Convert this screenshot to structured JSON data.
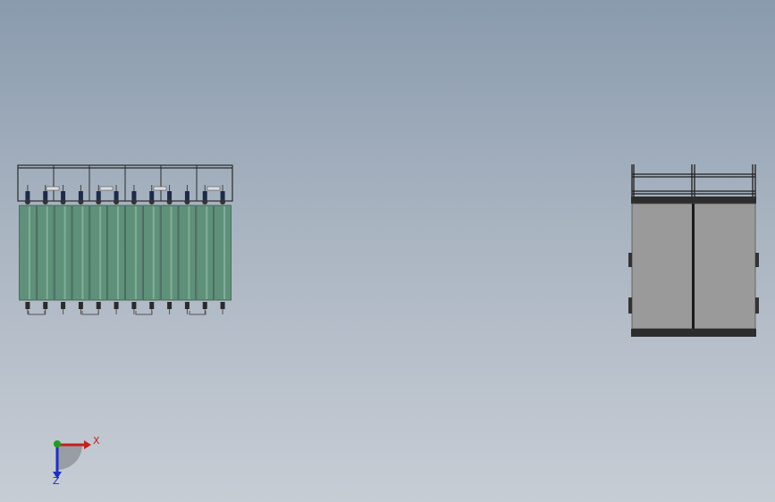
{
  "scene": {
    "background_top": "#8a9bae",
    "background_bottom": "#c7cdd5",
    "left_part": {
      "name": "cylinder-rack-front-view",
      "cylinder_count": 12,
      "cylinder_color": "#5f917a",
      "frame_color": "#2b2b2b"
    },
    "right_part": {
      "name": "cabinet-side-view",
      "panel_color": "#9a9a9a",
      "band_color": "#2d2d2d"
    }
  },
  "triad": {
    "x_label": "X",
    "z_label": "Z",
    "x_color": "#c81e1e",
    "y_color": "#1e9e1e",
    "z_color": "#1e2ec8"
  }
}
